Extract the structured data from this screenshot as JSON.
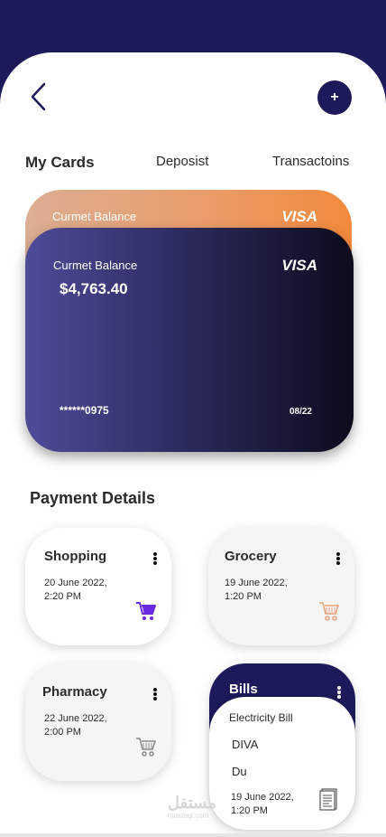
{
  "header": {
    "add_label": "+"
  },
  "tabs": [
    {
      "label": "My Cards"
    },
    {
      "label": "Deposist"
    },
    {
      "label": "Transactoins"
    }
  ],
  "cards": {
    "back": {
      "balance_label": "Curmet Balance",
      "brand": "VISA"
    },
    "front": {
      "balance_label": "Curmet Balance",
      "amount": "$4,763.40",
      "brand": "VISA",
      "number": "******0975",
      "expiry": "08/22"
    }
  },
  "payment": {
    "title": "Payment Details",
    "items": [
      {
        "title": "Shopping",
        "date": "20 June 2022,\n2:20 PM",
        "icon": "cart-icon",
        "icon_color": "#6a2be0"
      },
      {
        "title": "Grocery",
        "date": "19 June 2022,\n1:20 PM",
        "icon": "cart-icon",
        "icon_color": "#e8a27a"
      },
      {
        "title": "Pharmacy",
        "date": "22 June 2022,\n2:00 PM",
        "icon": "cart-icon",
        "icon_color": "#8a8a8a"
      }
    ],
    "bills": {
      "title": "Bills",
      "line1": "Electricity Bill",
      "line2": "DIVA",
      "line3": "Du",
      "date": "19 June 2022,\n1:20 PM",
      "icon": "receipt-icon"
    }
  },
  "watermark": {
    "text": "مستقل",
    "sub": "mostaql.com"
  },
  "colors": {
    "primary": "#1c1a5a",
    "card_orange": "#f38a3c",
    "card_purple": "#4e4c98"
  }
}
